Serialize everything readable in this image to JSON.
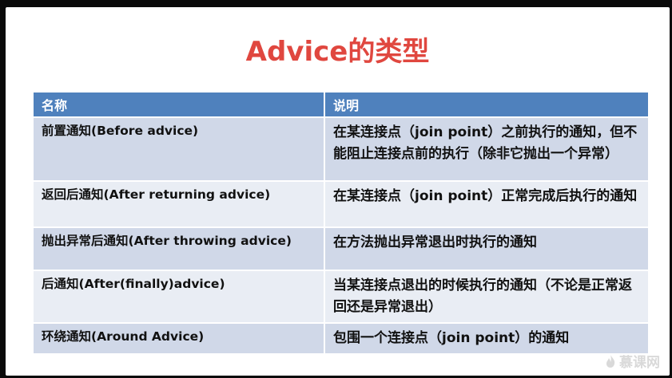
{
  "slide": {
    "title": "Advice的类型",
    "table": {
      "headers": [
        "名称",
        "说明"
      ],
      "rows": [
        {
          "name": "前置通知(Before advice)",
          "description": "在某连接点（join point）之前执行的通知，但不能阻止连接点前的执行（除非它抛出一个异常）"
        },
        {
          "name": "返回后通知(After returning advice)",
          "description": "在某连接点（join point）正常完成后执行的通知"
        },
        {
          "name": "抛出异常后通知(After throwing advice)",
          "description": "在方法抛出异常退出时执行的通知"
        },
        {
          "name": "后通知(After(finally)advice)",
          "description": "当某连接点退出的时候执行的通知（不论是正常返回还是异常退出）"
        },
        {
          "name": "环绕通知(Around Advice)",
          "description": "包围一个连接点（join point）的通知"
        }
      ]
    }
  },
  "watermark": {
    "text": "慕课网",
    "icon": "flame-icon",
    "color": "#d9d9d9"
  },
  "colors": {
    "title": "#e0473f",
    "header_bg": "#4f81bd",
    "row_dark": "#d0d8e8",
    "row_light": "#e9edf4"
  }
}
